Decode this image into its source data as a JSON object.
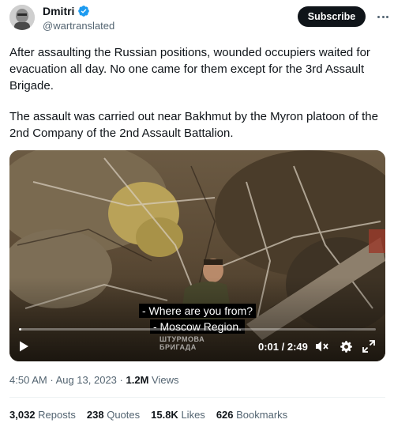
{
  "author": {
    "name": "Dmitri",
    "handle": "@wartranslated"
  },
  "subscribe_label": "Subscribe",
  "tweet": {
    "paragraph1": "After assaulting the Russian positions, wounded occupiers waited for evacuation all day. No one came for them except for the 3rd Assault Brigade.",
    "paragraph2": "The assault was carried out near Bakhmut by the Myron platoon of the 2nd Company of the 2nd Assault Battalion."
  },
  "video": {
    "subtitle_line1": "- Where are you from?",
    "subtitle_line2": "- Moscow Region.",
    "watermark_line1": "ШТУРМОВА",
    "watermark_line2": "БРИГАДА",
    "time": "0:01 / 2:49",
    "progress": 0.006
  },
  "meta": {
    "time": "4:50 AM",
    "date": "Aug 13, 2023",
    "views_count": "1.2M",
    "views_label": "Views"
  },
  "stats": [
    {
      "count": "3,032",
      "label": "Reposts"
    },
    {
      "count": "238",
      "label": "Quotes"
    },
    {
      "count": "15.8K",
      "label": "Likes"
    },
    {
      "count": "626",
      "label": "Bookmarks"
    }
  ],
  "colors": {
    "verified": "#1d9bf0",
    "muted": "#536471",
    "text": "#0f1419"
  },
  "icons": [
    "verified-badge-icon",
    "more-icon",
    "play-icon",
    "volume-icon",
    "settings-icon",
    "fullscreen-icon"
  ]
}
